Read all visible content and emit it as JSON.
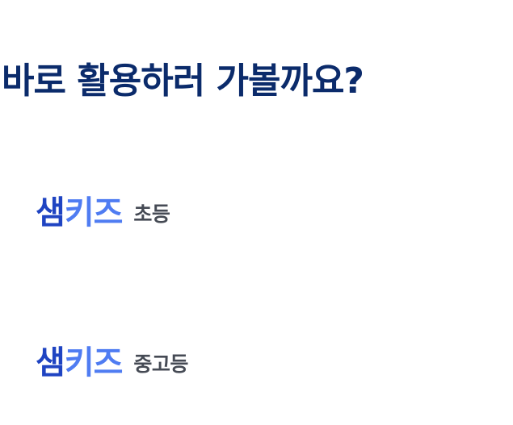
{
  "headline": "바로 활용하러 가볼까요?",
  "brand": {
    "logo_part1": "샘",
    "logo_part2": "키즈",
    "colors": {
      "part1": "#1f44c2",
      "part2": "#4f7cf2",
      "headline": "#0b2b6b",
      "level_text": "#454a54"
    }
  },
  "links": [
    {
      "level": "초등"
    },
    {
      "level": "중고등"
    }
  ]
}
